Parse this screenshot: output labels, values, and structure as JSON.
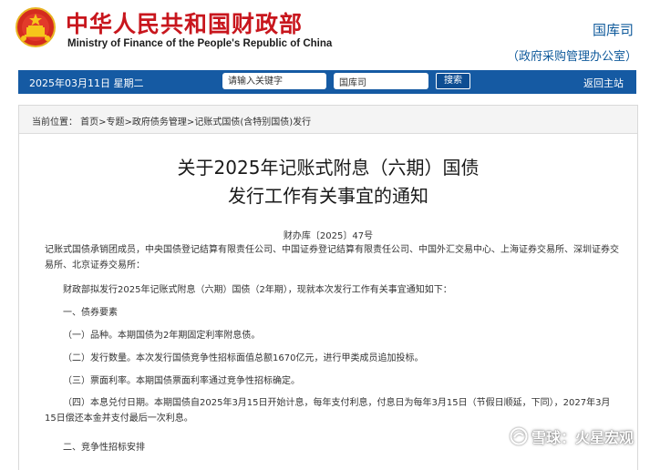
{
  "header": {
    "title_cn": "中华人民共和国财政部",
    "title_en": "Ministry of Finance of the People's Republic of China",
    "department": "国库司",
    "department_sub": "（政府采购管理办公室）",
    "emblem_icon": "national-emblem-icon"
  },
  "nav": {
    "date": "2025年03月11日   星期二",
    "search_placeholder": "请输入关键字",
    "scope_selected": "国库司",
    "search_label": "搜索",
    "home_label": "返回主站",
    "bar_color": "#155aa3"
  },
  "breadcrumb": "当前位置： 首页>专题>政府债务管理>记账式国债(含特别国债)发行",
  "document": {
    "title_line1": "关于2025年记账式附息（六期）国债",
    "title_line2": "发行工作有关事宜的通知",
    "doc_number": "财办库〔2025〕47号",
    "addressees": "记账式国债承销团成员，中央国债登记结算有限责任公司、中国证券登记结算有限责任公司、中国外汇交易中心、上海证券交易所、深圳证券交易所、北京证券交易所：",
    "intro": "财政部拟发行2025年记账式附息（六期）国债（2年期），现就本次发行工作有关事宜通知如下：",
    "section1": "一、债券要素",
    "item1": "（一）品种。本期国债为2年期固定利率附息债。",
    "item2": "（二）发行数量。本次发行国债竞争性招标面值总额1670亿元，进行甲类成员追加投标。",
    "item3": "（三）票面利率。本期国债票面利率通过竞争性招标确定。",
    "item4": "（四）本息兑付日期。本期国债自2025年3月15日开始计息，每年支付利息，付息日为每年3月15日（节假日顺延，下同），2027年3月15日偿还本金并支付最后一次利息。",
    "section2": "二、竞争性招标安排"
  },
  "watermark": {
    "text": "雪球：火星宏观",
    "icon": "snowball-logo-icon"
  },
  "colors": {
    "title_red": "#c8161d",
    "link_blue": "#0f5a9b"
  }
}
